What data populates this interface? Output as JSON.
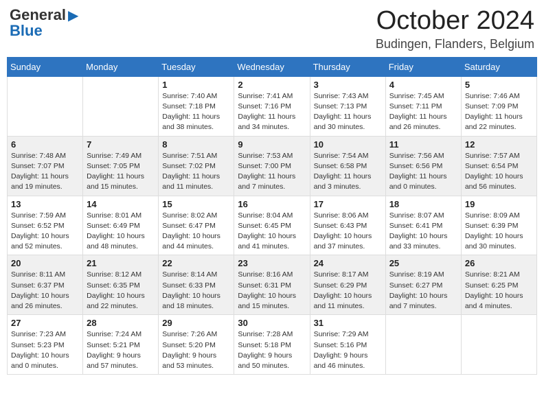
{
  "header": {
    "logo_general": "General",
    "logo_blue": "Blue",
    "month_title": "October 2024",
    "location": "Budingen, Flanders, Belgium"
  },
  "days_of_week": [
    "Sunday",
    "Monday",
    "Tuesday",
    "Wednesday",
    "Thursday",
    "Friday",
    "Saturday"
  ],
  "weeks": [
    [
      {
        "day": "",
        "info": ""
      },
      {
        "day": "",
        "info": ""
      },
      {
        "day": "1",
        "info": "Sunrise: 7:40 AM\nSunset: 7:18 PM\nDaylight: 11 hours and 38 minutes."
      },
      {
        "day": "2",
        "info": "Sunrise: 7:41 AM\nSunset: 7:16 PM\nDaylight: 11 hours and 34 minutes."
      },
      {
        "day": "3",
        "info": "Sunrise: 7:43 AM\nSunset: 7:13 PM\nDaylight: 11 hours and 30 minutes."
      },
      {
        "day": "4",
        "info": "Sunrise: 7:45 AM\nSunset: 7:11 PM\nDaylight: 11 hours and 26 minutes."
      },
      {
        "day": "5",
        "info": "Sunrise: 7:46 AM\nSunset: 7:09 PM\nDaylight: 11 hours and 22 minutes."
      }
    ],
    [
      {
        "day": "6",
        "info": "Sunrise: 7:48 AM\nSunset: 7:07 PM\nDaylight: 11 hours and 19 minutes."
      },
      {
        "day": "7",
        "info": "Sunrise: 7:49 AM\nSunset: 7:05 PM\nDaylight: 11 hours and 15 minutes."
      },
      {
        "day": "8",
        "info": "Sunrise: 7:51 AM\nSunset: 7:02 PM\nDaylight: 11 hours and 11 minutes."
      },
      {
        "day": "9",
        "info": "Sunrise: 7:53 AM\nSunset: 7:00 PM\nDaylight: 11 hours and 7 minutes."
      },
      {
        "day": "10",
        "info": "Sunrise: 7:54 AM\nSunset: 6:58 PM\nDaylight: 11 hours and 3 minutes."
      },
      {
        "day": "11",
        "info": "Sunrise: 7:56 AM\nSunset: 6:56 PM\nDaylight: 11 hours and 0 minutes."
      },
      {
        "day": "12",
        "info": "Sunrise: 7:57 AM\nSunset: 6:54 PM\nDaylight: 10 hours and 56 minutes."
      }
    ],
    [
      {
        "day": "13",
        "info": "Sunrise: 7:59 AM\nSunset: 6:52 PM\nDaylight: 10 hours and 52 minutes."
      },
      {
        "day": "14",
        "info": "Sunrise: 8:01 AM\nSunset: 6:49 PM\nDaylight: 10 hours and 48 minutes."
      },
      {
        "day": "15",
        "info": "Sunrise: 8:02 AM\nSunset: 6:47 PM\nDaylight: 10 hours and 44 minutes."
      },
      {
        "day": "16",
        "info": "Sunrise: 8:04 AM\nSunset: 6:45 PM\nDaylight: 10 hours and 41 minutes."
      },
      {
        "day": "17",
        "info": "Sunrise: 8:06 AM\nSunset: 6:43 PM\nDaylight: 10 hours and 37 minutes."
      },
      {
        "day": "18",
        "info": "Sunrise: 8:07 AM\nSunset: 6:41 PM\nDaylight: 10 hours and 33 minutes."
      },
      {
        "day": "19",
        "info": "Sunrise: 8:09 AM\nSunset: 6:39 PM\nDaylight: 10 hours and 30 minutes."
      }
    ],
    [
      {
        "day": "20",
        "info": "Sunrise: 8:11 AM\nSunset: 6:37 PM\nDaylight: 10 hours and 26 minutes."
      },
      {
        "day": "21",
        "info": "Sunrise: 8:12 AM\nSunset: 6:35 PM\nDaylight: 10 hours and 22 minutes."
      },
      {
        "day": "22",
        "info": "Sunrise: 8:14 AM\nSunset: 6:33 PM\nDaylight: 10 hours and 18 minutes."
      },
      {
        "day": "23",
        "info": "Sunrise: 8:16 AM\nSunset: 6:31 PM\nDaylight: 10 hours and 15 minutes."
      },
      {
        "day": "24",
        "info": "Sunrise: 8:17 AM\nSunset: 6:29 PM\nDaylight: 10 hours and 11 minutes."
      },
      {
        "day": "25",
        "info": "Sunrise: 8:19 AM\nSunset: 6:27 PM\nDaylight: 10 hours and 7 minutes."
      },
      {
        "day": "26",
        "info": "Sunrise: 8:21 AM\nSunset: 6:25 PM\nDaylight: 10 hours and 4 minutes."
      }
    ],
    [
      {
        "day": "27",
        "info": "Sunrise: 7:23 AM\nSunset: 5:23 PM\nDaylight: 10 hours and 0 minutes."
      },
      {
        "day": "28",
        "info": "Sunrise: 7:24 AM\nSunset: 5:21 PM\nDaylight: 9 hours and 57 minutes."
      },
      {
        "day": "29",
        "info": "Sunrise: 7:26 AM\nSunset: 5:20 PM\nDaylight: 9 hours and 53 minutes."
      },
      {
        "day": "30",
        "info": "Sunrise: 7:28 AM\nSunset: 5:18 PM\nDaylight: 9 hours and 50 minutes."
      },
      {
        "day": "31",
        "info": "Sunrise: 7:29 AM\nSunset: 5:16 PM\nDaylight: 9 hours and 46 minutes."
      },
      {
        "day": "",
        "info": ""
      },
      {
        "day": "",
        "info": ""
      }
    ]
  ]
}
